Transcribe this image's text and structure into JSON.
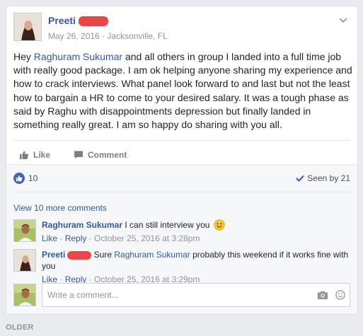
{
  "post": {
    "author_name": "Preeti",
    "date": "May 26, 2016",
    "separator": " · ",
    "location": "Jacksonville, FL",
    "text_before_mention": "Hey ",
    "mention": "Raghuram Sukumar",
    "text_after_mention": " and all others in group I landed into a full time job with really good package. I am ok helping anyone sharing my experience and how to crack interviews. What panel look forward to and last but not the least how to bargain a HR to come to your desired salary. It was a tough phase as said by Raghu with disappointments depression but finally landed in something really great. I am so happy do sharing with you all."
  },
  "actions": {
    "like_label": "Like",
    "comment_label": "Comment"
  },
  "feedback": {
    "like_count": "10",
    "seen_label": "Seen by 21",
    "view_more": "View 10 more comments"
  },
  "comments": [
    {
      "author": "Raghuram Sukumar",
      "text": " I can still interview you",
      "like": "Like",
      "reply": "Reply",
      "dot": " · ",
      "time": "October 25, 2016 at 3:28pm"
    },
    {
      "author": "Preeti",
      "text_before": "Sure ",
      "mention": "Raghuram Sukumar",
      "text_after": " probably this weekend if it works fine with you",
      "like": "Like",
      "reply": "Reply",
      "dot": " · ",
      "time": "October 25, 2016 at 3:29pm"
    }
  ],
  "reply_box": {
    "placeholder": "Write a comment..."
  },
  "footer": {
    "older_label": "OLDER"
  },
  "colors": {
    "link": "#365899",
    "like_blue": "#4267b2",
    "redaction": "#e8474a",
    "background": "#e9ebee"
  }
}
